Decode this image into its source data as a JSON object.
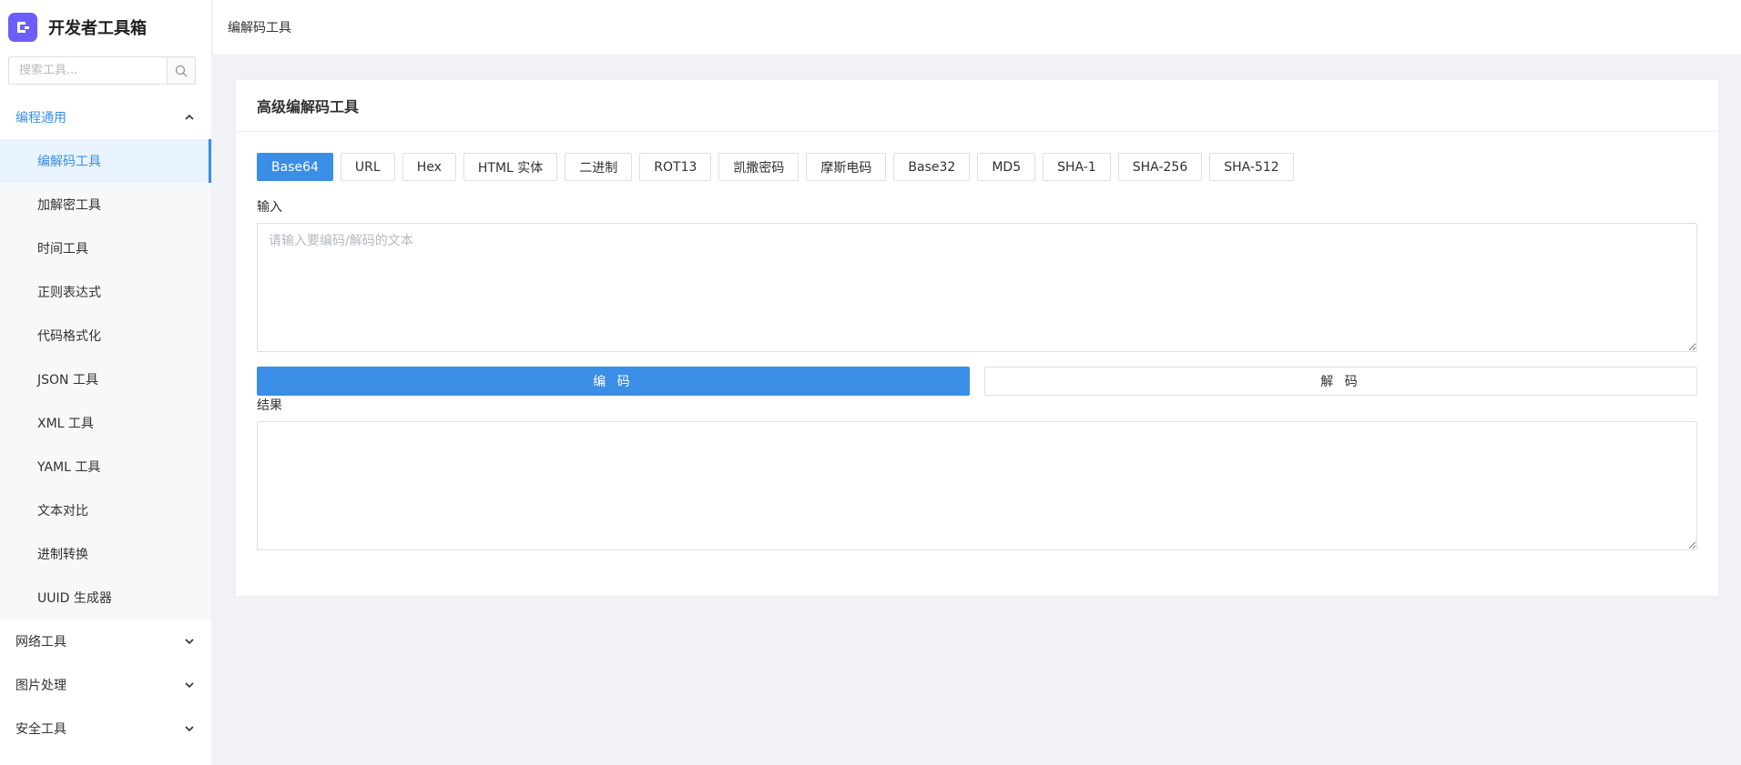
{
  "app": {
    "title": "开发者工具箱"
  },
  "search": {
    "placeholder": "搜索工具..."
  },
  "sidebar": {
    "groups": [
      {
        "label": "编程通用",
        "expanded": true,
        "items": [
          {
            "label": "编解码工具",
            "active": true
          },
          {
            "label": "加解密工具"
          },
          {
            "label": "时间工具"
          },
          {
            "label": "正则表达式"
          },
          {
            "label": "代码格式化"
          },
          {
            "label": "JSON 工具"
          },
          {
            "label": "XML 工具"
          },
          {
            "label": "YAML 工具"
          },
          {
            "label": "文本对比"
          },
          {
            "label": "进制转换"
          },
          {
            "label": "UUID 生成器"
          }
        ]
      },
      {
        "label": "网络工具",
        "expanded": false
      },
      {
        "label": "图片处理",
        "expanded": false
      },
      {
        "label": "安全工具",
        "expanded": false
      }
    ]
  },
  "breadcrumb": {
    "current": "编解码工具"
  },
  "card": {
    "title": "高级编解码工具",
    "tabs": [
      "Base64",
      "URL",
      "Hex",
      "HTML 实体",
      "二进制",
      "ROT13",
      "凯撒密码",
      "摩斯电码",
      "Base32",
      "MD5",
      "SHA-1",
      "SHA-256",
      "SHA-512"
    ],
    "active_tab": "Base64",
    "input_label": "输入",
    "input_placeholder": "请输入要编码/解码的文本",
    "input_value": "",
    "encode_label": "编 码",
    "decode_label": "解 码",
    "result_label": "结果",
    "result_value": ""
  },
  "colors": {
    "accent": "#3a8ee6",
    "logo": "#6d5dfc"
  }
}
